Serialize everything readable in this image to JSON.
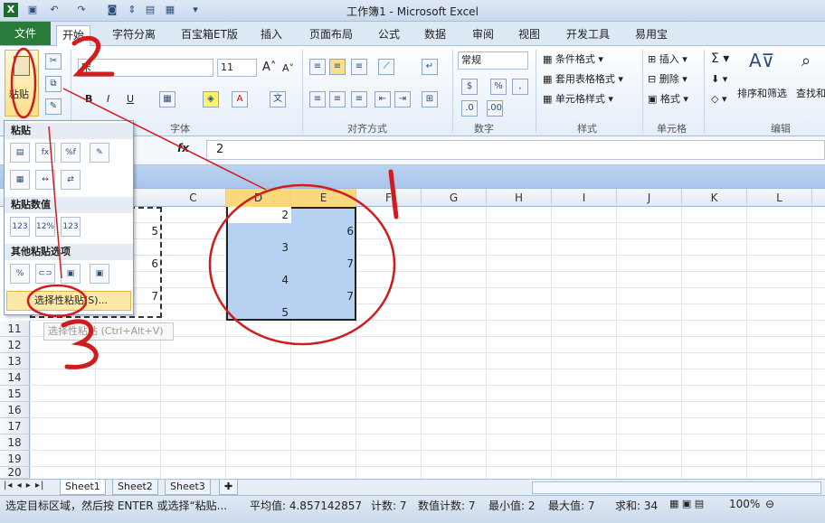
{
  "app": {
    "title": "工作簿1 - Microsoft Excel"
  },
  "tabs": [
    "文件",
    "开始",
    "字符分离",
    "百宝箱ET版",
    "插入",
    "页面布局",
    "公式",
    "数据",
    "审阅",
    "视图",
    "开发工具",
    "易用宝"
  ],
  "ribbon": {
    "font_name": "宋",
    "font_size": "11",
    "number_format": "常规",
    "groups": [
      "字体",
      "对齐方式",
      "数字",
      "样式",
      "单元格",
      "编辑"
    ],
    "styles": [
      "条件格式",
      "套用表格格式",
      "单元格样式"
    ],
    "cells": [
      "插入",
      "删除",
      "格式"
    ],
    "editing": [
      "排序和筛选",
      "查找和"
    ],
    "paste_label": "粘贴",
    "font_buttons": [
      "B",
      "I",
      "U"
    ]
  },
  "formula_bar": {
    "fx": "fx",
    "value": "2"
  },
  "columns": [
    "C",
    "D",
    "E",
    "F",
    "G",
    "H",
    "I",
    "J",
    "K",
    "L"
  ],
  "rows": [
    "11",
    "12",
    "13",
    "14",
    "15",
    "16",
    "17",
    "18",
    "19",
    "20"
  ],
  "cells": {
    "b": [
      "5",
      "6",
      "7"
    ],
    "d": [
      "2",
      "3",
      "4",
      "5"
    ],
    "e": [
      "6",
      "7",
      "7"
    ]
  },
  "paste_menu": {
    "section_paste": "粘贴",
    "section_values": "粘贴数值",
    "section_other": "其他粘贴选项",
    "paste_special": "选择性粘贴(S)...",
    "tooltip": "选择性粘贴 (Ctrl+Alt+V)"
  },
  "sheets": [
    "Sheet1",
    "Sheet2",
    "Sheet3"
  ],
  "status": {
    "message": "选定目标区域，然后按 ENTER 或选择“粘贴...",
    "average": "平均值: 4.857142857",
    "count": "计数: 7",
    "numcount": "数值计数: 7",
    "min": "最小值: 2",
    "max": "最大值: 7",
    "sum": "求和: 34",
    "zoom": "100%"
  },
  "annotations": [
    "1",
    "2",
    "3"
  ],
  "colors": {
    "selection": "#b6d1f1",
    "file_tab": "#2a7a3a",
    "annotation": "#d01c1c"
  }
}
